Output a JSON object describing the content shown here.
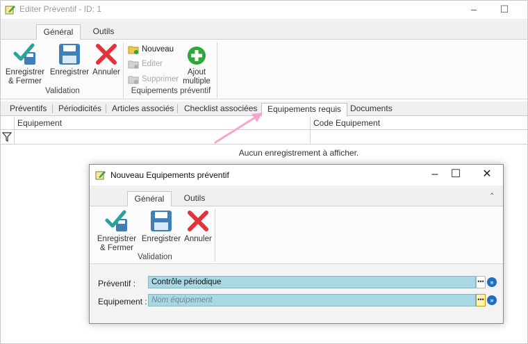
{
  "main_window": {
    "title": "Editer Préventif - ID: 1",
    "ribbon_tabs": [
      "Général",
      "Outils"
    ],
    "validation_group": {
      "label": "Validation",
      "save_close": "Enregistrer & Fermer",
      "save": "Enregistrer",
      "cancel": "Annuler"
    },
    "equipements_group": {
      "label": "Equipements préventif",
      "nouveau": "Nouveau",
      "editer": "Editer",
      "supprimer": "Supprimer",
      "ajout_multiple": "Ajout multiple"
    },
    "tabs": [
      "Préventifs",
      "Périodicités",
      "Articles associés",
      "Checklist associées",
      "Equipements requis",
      "Documents"
    ],
    "active_tab": "Equipements requis",
    "grid": {
      "columns": [
        "Equipement",
        "Code Equipement"
      ],
      "empty_message": "Aucun enregistrement à afficher."
    }
  },
  "dialog": {
    "title": "Nouveau Equipements préventif",
    "ribbon_tabs": [
      "Général",
      "Outils"
    ],
    "validation_group": {
      "label": "Validation",
      "save_close": "Enregistrer & Fermer",
      "save": "Enregistrer",
      "cancel": "Annuler"
    },
    "fields": {
      "preventif_label": "Préventif :",
      "preventif_value": "Contrôle périodique",
      "equipement_label": "Equipement :",
      "equipement_placeholder": "Nom équipement"
    }
  },
  "colors": {
    "field_bg": "#a8d8e3",
    "accent_arrow": "#f4a6cf",
    "cancel_red": "#e0333b",
    "save_blue": "#3f7fb7",
    "check_teal": "#2aa39a",
    "add_green": "#2ea836"
  },
  "icons": {
    "window": "edit-note-icon",
    "save_close": "check-save-icon",
    "save": "floppy-disk-icon",
    "cancel": "red-x-icon",
    "new": "folder-new-icon",
    "edit": "edit-icon",
    "delete": "delete-icon",
    "add_multiple": "green-plus-icon",
    "filter": "filter-icon"
  }
}
